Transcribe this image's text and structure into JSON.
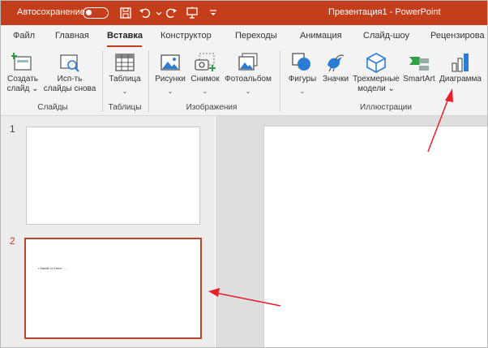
{
  "titlebar": {
    "autosave_label": "Автосохранение",
    "doc_title": "Презентация1  -  PowerPoint"
  },
  "tabs": [
    {
      "label": "Файл"
    },
    {
      "label": "Главная"
    },
    {
      "label": "Вставка"
    },
    {
      "label": "Конструктор"
    },
    {
      "label": "Переходы"
    },
    {
      "label": "Анимация"
    },
    {
      "label": "Слайд-шоу"
    },
    {
      "label": "Рецензирова"
    }
  ],
  "ribbon": {
    "new_slide": {
      "line1": "Создать",
      "line2": "слайд ⌄"
    },
    "reuse_slides": {
      "line1": "Исп-ть",
      "line2": "слайды снова"
    },
    "table": {
      "label": "Таблица"
    },
    "pictures": {
      "label": "Рисунки"
    },
    "screenshot": {
      "label": "Снимок"
    },
    "photo_album": {
      "label": "Фотоальбом"
    },
    "shapes": {
      "label": "Фигуры"
    },
    "icons": {
      "label": "Значки"
    },
    "models3d": {
      "line1": "Трехмерные",
      "line2": "модели ⌄"
    },
    "smartart": {
      "label": "SmartArt"
    },
    "chart": {
      "label": "Диаграмма"
    },
    "chevron": "⌄",
    "groups": {
      "slides": "Слайды",
      "tables": "Таблицы",
      "images": "Изображения",
      "illustrations": "Иллюстрации"
    }
  },
  "slides": [
    {
      "number": "1"
    },
    {
      "number": "2",
      "text": "• Какой-то текст……"
    }
  ],
  "colors": {
    "accent": "#c43e1c",
    "arrow": "#e8202a"
  }
}
